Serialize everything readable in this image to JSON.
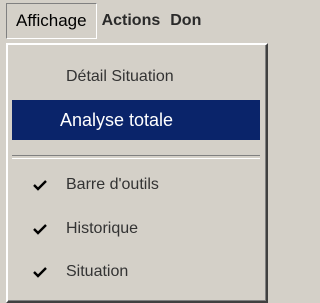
{
  "menubar": {
    "items": [
      {
        "label": "Affichage"
      },
      {
        "label": "Actions"
      },
      {
        "label": "Don"
      }
    ]
  },
  "menu": {
    "items": [
      {
        "label": "Détail Situation",
        "enabled": true
      },
      {
        "label": "Analyse totale",
        "highlighted": true
      },
      {
        "label": "Barre d'outils",
        "checked": true
      },
      {
        "label": "Historique",
        "checked": true
      },
      {
        "label": "Situation",
        "checked": true
      }
    ]
  },
  "colors": {
    "menu_bg": "#d4d0c8",
    "highlight": "#0a246a",
    "highlight_text": "#ffffff"
  }
}
